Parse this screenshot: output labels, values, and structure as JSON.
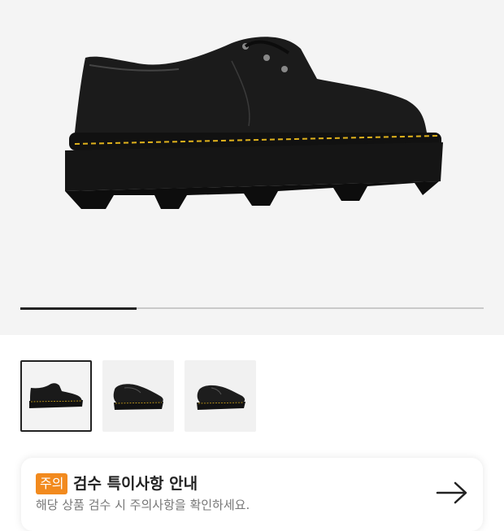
{
  "product": {
    "image_icon": "black-platform-derby-shoe",
    "gallery_progress": 0.25
  },
  "thumbnails": [
    {
      "icon": "shoe-side-view",
      "selected": true
    },
    {
      "icon": "shoe-three-quarter-view",
      "selected": false
    },
    {
      "icon": "shoe-angled-view",
      "selected": false
    }
  ],
  "notice": {
    "badge": "주의",
    "title": "검수 특이사항 안내",
    "description": "해당 상품 검수 시 주의사항을 확인하세요.",
    "arrow_icon": "arrow-right-icon"
  },
  "colors": {
    "accent": "#f28a1e",
    "stitch": "#e0b21c"
  }
}
